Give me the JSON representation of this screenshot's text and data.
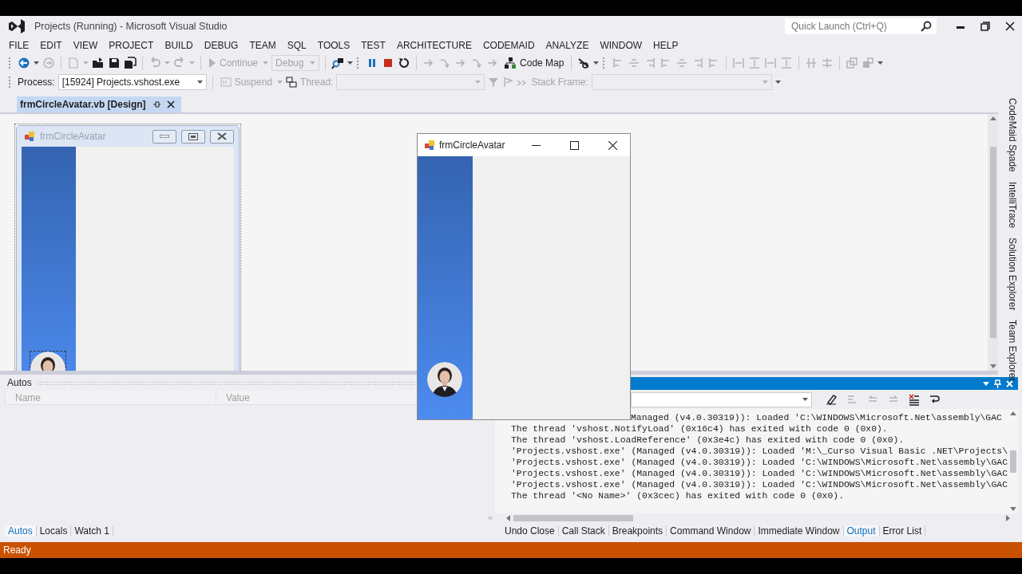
{
  "window": {
    "title": "Projects (Running) - Microsoft Visual Studio"
  },
  "quick_launch": {
    "placeholder": "Quick Launch (Ctrl+Q)"
  },
  "menu": [
    "FILE",
    "EDIT",
    "VIEW",
    "PROJECT",
    "BUILD",
    "DEBUG",
    "TEAM",
    "SQL",
    "TOOLS",
    "TEST",
    "ARCHITECTURE",
    "CODEMAID",
    "ANALYZE",
    "WINDOW",
    "HELP"
  ],
  "debug_toolbar": {
    "continue": {
      "label": "Continue",
      "disabled": true
    },
    "configuration": {
      "value": "Debug",
      "disabled": true
    },
    "code_map": {
      "label": "Code Map",
      "disabled": false
    }
  },
  "location_toolbar": {
    "process_label": "Process:",
    "process": {
      "value": "[15924] Projects.vshost.exe"
    },
    "suspend": {
      "label": "Suspend",
      "disabled": true
    },
    "thread": {
      "label": "Thread:",
      "disabled": true
    },
    "stack_frame": {
      "label": "Stack Frame:",
      "disabled": true
    }
  },
  "document_tabs": [
    {
      "label": "frmCircleAvatar.vb [Design]",
      "selected": true
    }
  ],
  "designer_form": {
    "title": "frmCircleAvatar"
  },
  "running_form": {
    "title": "frmCircleAvatar"
  },
  "side_tabs": [
    "CodeMaid Spade",
    "IntelliTrace",
    "Solution Explorer",
    "Team Explorer"
  ],
  "autos": {
    "title": "Autos",
    "columns": [
      "Name",
      "Value"
    ]
  },
  "debug_tabs": [
    {
      "label": "Autos",
      "selected": true
    },
    {
      "label": "Locals",
      "selected": false
    },
    {
      "label": "Watch 1",
      "selected": false
    }
  ],
  "output": {
    "lines": [
      "Managed (v4.0.30319)): Loaded 'C:\\WINDOWS\\Microsoft.Net\\assembly\\GAC",
      "The thread 'vshost.NotifyLoad' (0x16c4) has exited with code 0 (0x0).",
      "The thread 'vshost.LoadReference' (0x3e4c) has exited with code 0 (0x0).",
      "'Projects.vshost.exe' (Managed (v4.0.30319)): Loaded 'M:\\_Curso Visual Basic .NET\\Projects\\",
      "'Projects.vshost.exe' (Managed (v4.0.30319)): Loaded 'C:\\WINDOWS\\Microsoft.Net\\assembly\\GAC",
      "'Projects.vshost.exe' (Managed (v4.0.30319)): Loaded 'C:\\WINDOWS\\Microsoft.Net\\assembly\\GAC",
      "'Projects.vshost.exe' (Managed (v4.0.30319)): Loaded 'C:\\WINDOWS\\Microsoft.Net\\assembly\\GAC",
      "The thread '<No Name>' (0x3cec) has exited with code 0 (0x0)."
    ]
  },
  "output_tabs": [
    {
      "label": "Undo Close",
      "selected": false
    },
    {
      "label": "Call Stack",
      "selected": false
    },
    {
      "label": "Breakpoints",
      "selected": false
    },
    {
      "label": "Command Window",
      "selected": false
    },
    {
      "label": "Immediate Window",
      "selected": false
    },
    {
      "label": "Output",
      "selected": true
    },
    {
      "label": "Error List",
      "selected": false
    }
  ],
  "status_bar": {
    "text": "Ready"
  }
}
